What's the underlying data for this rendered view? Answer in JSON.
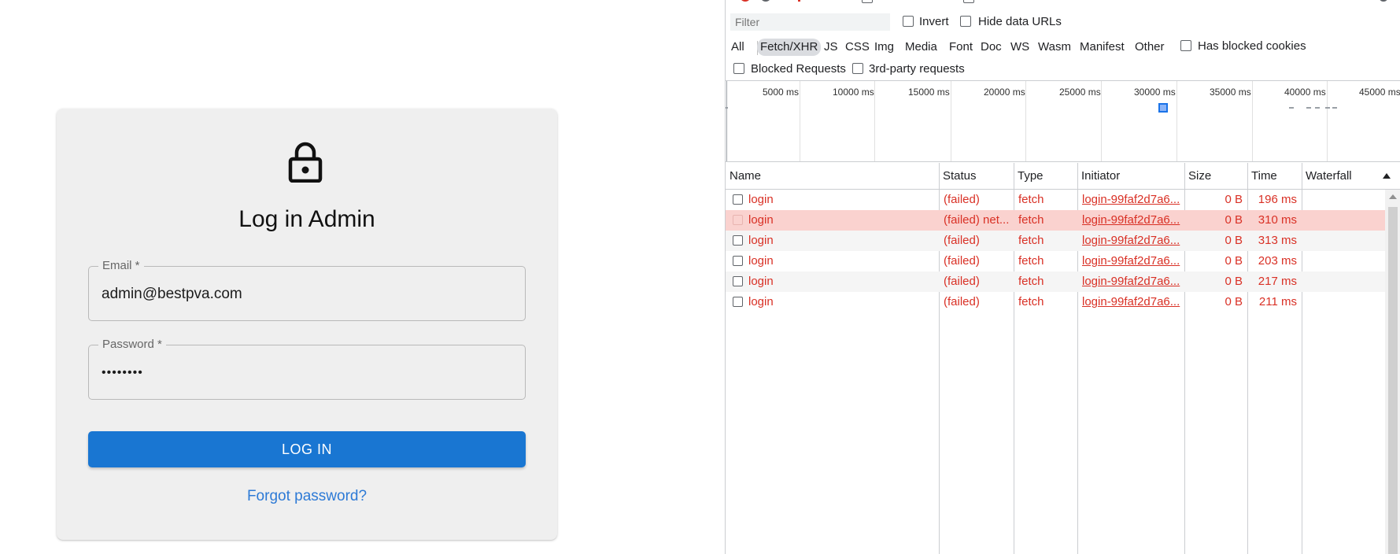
{
  "login": {
    "title": "Log in Admin",
    "email_label": "Email *",
    "email_value": "admin@bestpva.com",
    "password_label": "Password *",
    "password_value": "••••••••",
    "button_label": "LOG IN",
    "forgot_label": "Forgot password?"
  },
  "devtools": {
    "filter_placeholder": "Filter",
    "invert_label": "Invert",
    "hide_data_urls_label": "Hide data URLs",
    "type_filters": [
      "All",
      "Fetch/XHR",
      "JS",
      "CSS",
      "Img",
      "Media",
      "Font",
      "Doc",
      "WS",
      "Wasm",
      "Manifest",
      "Other"
    ],
    "active_type_filter": "Fetch/XHR",
    "has_blocked_cookies_label": "Has blocked cookies",
    "blocked_requests_label": "Blocked Requests",
    "third_party_label": "3rd-party requests",
    "timeline_ticks": [
      "5000 ms",
      "10000 ms",
      "15000 ms",
      "20000 ms",
      "25000 ms",
      "30000 ms",
      "35000 ms",
      "40000 ms",
      "45000 ms"
    ],
    "columns": [
      "Name",
      "Status",
      "Type",
      "Initiator",
      "Size",
      "Time",
      "Waterfall"
    ],
    "sort_icon": "triangle-up-icon",
    "rows": [
      {
        "name": "login",
        "status": "(failed)",
        "type": "fetch",
        "initiator": "login-99faf2d7a6...",
        "size": "0 B",
        "time": "196 ms"
      },
      {
        "name": "login",
        "status": "(failed) net...",
        "type": "fetch",
        "initiator": "login-99faf2d7a6...",
        "size": "0 B",
        "time": "310 ms"
      },
      {
        "name": "login",
        "status": "(failed)",
        "type": "fetch",
        "initiator": "login-99faf2d7a6...",
        "size": "0 B",
        "time": "313 ms"
      },
      {
        "name": "login",
        "status": "(failed)",
        "type": "fetch",
        "initiator": "login-99faf2d7a6...",
        "size": "0 B",
        "time": "203 ms"
      },
      {
        "name": "login",
        "status": "(failed)",
        "type": "fetch",
        "initiator": "login-99faf2d7a6...",
        "size": "0 B",
        "time": "217 ms"
      },
      {
        "name": "login",
        "status": "(failed)",
        "type": "fetch",
        "initiator": "login-99faf2d7a6...",
        "size": "0 B",
        "time": "211 ms"
      }
    ],
    "selected_row": 1,
    "error_color": "#d93025",
    "selected_row_color": "#fad2cf"
  },
  "colors": {
    "primary_button": "#1976d2",
    "link": "#2d7ad6",
    "card_bg": "#efefef"
  }
}
